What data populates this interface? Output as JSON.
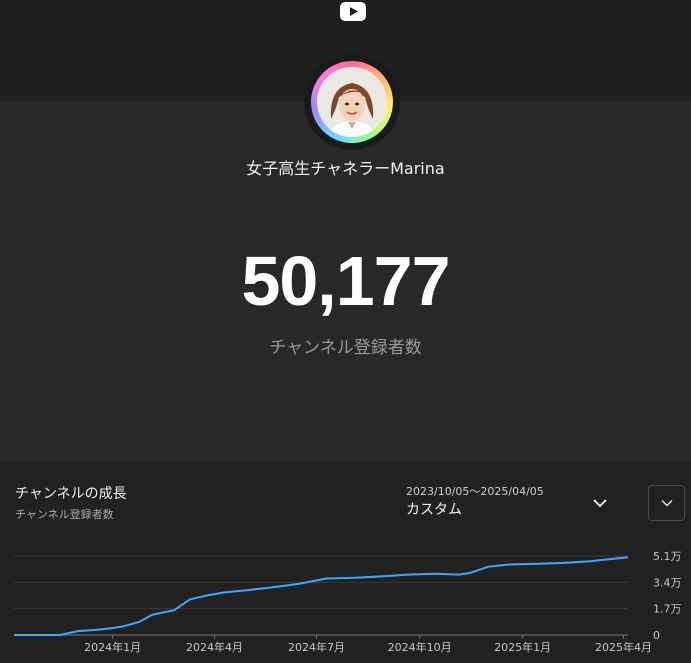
{
  "header": {
    "logo_icon": "youtube-play-icon",
    "channel_name": "女子高生チャネラーMarina",
    "avatar_icon": "channel-avatar"
  },
  "stats": {
    "subscriber_count": "50,177",
    "subscriber_label": "チャンネル登録者数"
  },
  "growth_panel": {
    "title": "チャンネルの成長",
    "subtitle": "チャンネル登録者数",
    "date_range": "2023/10/05〜2025/04/05",
    "range_label": "カスタム",
    "range_dropdown_icon": "chevron-down-icon",
    "expand_icon": "chevron-down-icon"
  },
  "colors": {
    "line": "#3ea6ff",
    "background": "#282828",
    "panel": "#212121"
  },
  "chart_data": {
    "type": "line",
    "title": "チャンネルの成長",
    "ylabel": "チャンネル登録者数",
    "x_tick_labels": [
      "2024年1月",
      "2024年4月",
      "2024年7月",
      "2024年10月",
      "2025年1月",
      "2025年4月"
    ],
    "y_tick_labels": [
      "0",
      "1.7万",
      "3.4万",
      "5.1万"
    ],
    "y_ticks": [
      0,
      17000,
      34000,
      51000
    ],
    "ylim": [
      0,
      51000
    ],
    "xlim": [
      "2023-10-05",
      "2025-04-05"
    ],
    "grid": true,
    "series": [
      {
        "x": [
          "2023-10-05",
          "2023-11-15",
          "2023-12-01",
          "2023-12-20",
          "2024-01-01",
          "2024-01-10",
          "2024-01-25",
          "2024-02-05",
          "2024-02-15",
          "2024-02-25",
          "2024-03-10",
          "2024-03-25",
          "2024-04-10",
          "2024-05-01",
          "2024-05-25",
          "2024-06-15",
          "2024-07-10",
          "2024-08-05",
          "2024-09-01",
          "2024-09-20",
          "2024-10-15",
          "2024-11-05",
          "2024-11-15",
          "2024-12-01",
          "2024-12-20",
          "2025-01-15",
          "2025-02-05",
          "2025-03-01",
          "2025-03-20",
          "2025-04-05"
        ],
        "y": [
          0,
          0,
          2500,
          3500,
          4500,
          5500,
          8500,
          13000,
          14500,
          16000,
          23000,
          25500,
          27500,
          29000,
          31000,
          33000,
          36500,
          37000,
          38000,
          39000,
          39500,
          39000,
          40000,
          44000,
          45500,
          46000,
          46500,
          47500,
          49000,
          50177
        ]
      }
    ]
  }
}
